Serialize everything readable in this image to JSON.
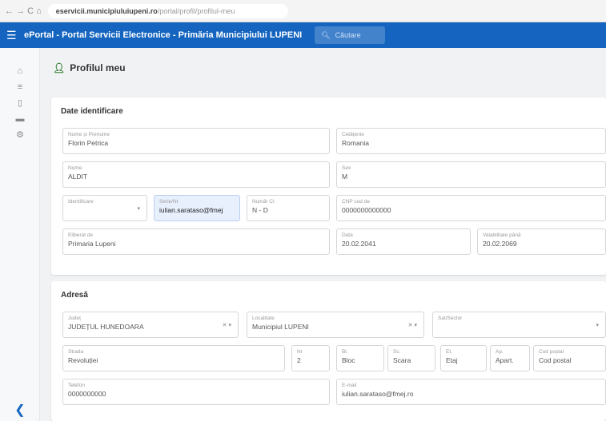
{
  "browser": {
    "nav_glyphs": "← → C ⌂",
    "url_domain": "eservicii.municipiuluiupeni.ro",
    "url_path": "/portal/profil/profilul-meu"
  },
  "header": {
    "title": "ePortal - Portal Servicii Electronice - Primăria Municipiului LUPENI",
    "search_placeholder": "Căutare"
  },
  "page_title": "Profilul meu",
  "identification": {
    "section_title": "Date identificare",
    "first_name": {
      "label": "Nume și Prenume",
      "value": "Florin Petrica"
    },
    "citizenship": {
      "label": "Cetățenie",
      "value": "Romania"
    },
    "last_name": {
      "label": "Nume",
      "value": "ALDIT"
    },
    "sex": {
      "label": "Sex",
      "value": "M"
    },
    "id_type": {
      "label": "Identificare"
    },
    "series": {
      "label": "Serie/Nr",
      "value": "iulian.sarataso@fmej"
    },
    "id_number": {
      "label": "Număr CI",
      "value": "N - D"
    },
    "cnp": {
      "label": "CNP cod de",
      "value": "0000000000000"
    },
    "issued_by": {
      "label": "Eliberat de",
      "value": "Primaria Lupeni"
    },
    "issue_date": {
      "label": "Data",
      "value": "20.02.2041"
    },
    "expiry_date": {
      "label": "Valabilitate până",
      "value": "20.02.2069"
    }
  },
  "address": {
    "section_title": "Adresă",
    "county": {
      "label": "Județ",
      "value": "JUDEȚUL HUNEDOARA"
    },
    "locality": {
      "label": "Localitate",
      "value": "Municipiul LUPENI"
    },
    "village": {
      "label": "Sat/Sector"
    },
    "street": {
      "label": "Strada",
      "value": "Revoluției"
    },
    "number": {
      "label": "Nr",
      "value": "2"
    },
    "block": {
      "label": "Bl.",
      "value": "Bloc"
    },
    "staircase": {
      "label": "Sc.",
      "value": "Scara"
    },
    "floor": {
      "label": "Et.",
      "value": "Etaj"
    },
    "apartment": {
      "label": "Ap.",
      "value": "Apart."
    },
    "postal_code": {
      "label": "Cod poștal",
      "value": "Cod postal"
    },
    "phone": {
      "label": "Telefon",
      "value": "0000000000"
    },
    "email": {
      "label": "E-mail",
      "value": "iulian.sarataso@fmej.ro"
    }
  },
  "icons": {
    "menu": "menu-icon",
    "user": "user-icon",
    "search": "search-icon",
    "sidebar": [
      "home-icon",
      "list-icon",
      "document-icon",
      "folder-icon",
      "settings-icon"
    ],
    "collapse": "collapse-icon"
  },
  "colors": {
    "primary": "#1565c0",
    "accent": "#2e7d32"
  }
}
